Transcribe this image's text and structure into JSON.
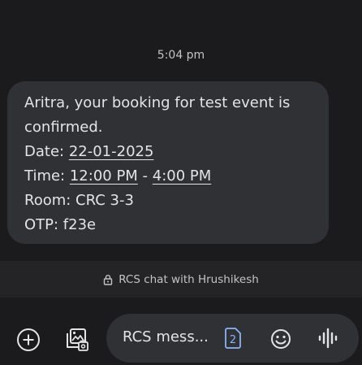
{
  "conversation": {
    "timestamp": "5:04 pm",
    "message": {
      "line1": "Aritra, your booking for test event is",
      "line2": "confirmed.",
      "date_label": "Date: ",
      "date_value": "22-01-2025",
      "time_label": "Time: ",
      "time_start": "12:00 PM",
      "time_sep": " - ",
      "time_end": "4:00 PM",
      "room": "Room: CRC 3-3",
      "otp": "OTP: f23e"
    }
  },
  "rcs_banner": {
    "icon": "lock-icon",
    "text": "RCS chat with Hrushikesh"
  },
  "composer": {
    "placeholder": "RCS mess...",
    "sim_number": "2",
    "icons": [
      "add-icon",
      "gallery-icon",
      "sim-icon",
      "emoji-icon",
      "voice-icon"
    ]
  },
  "colors": {
    "background": "#1b1b1d",
    "bubble": "#303134",
    "sim_accent": "#8ab4f8"
  }
}
